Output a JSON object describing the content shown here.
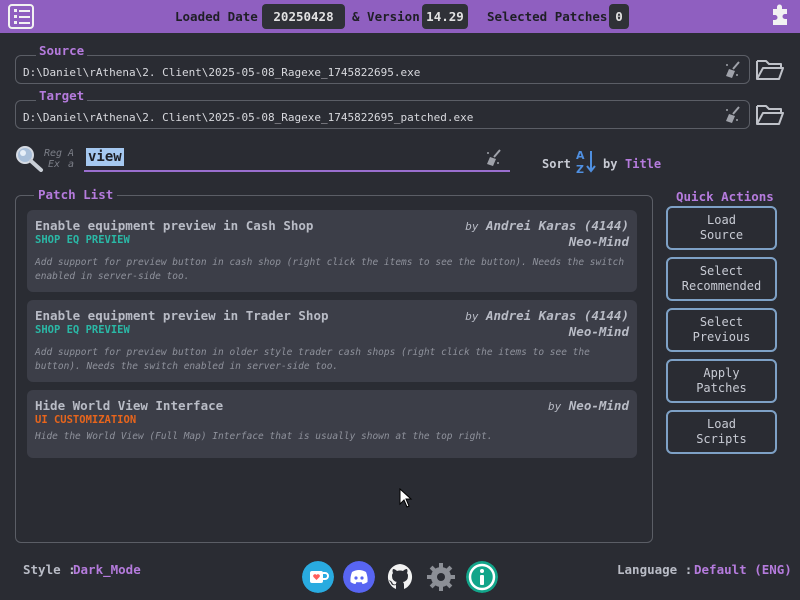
{
  "topbar": {
    "loaded_date_label": "Loaded Date",
    "loaded_date_value": "20250428",
    "version_label": "& Version",
    "version_value": "14.29",
    "selected_label": "Selected Patches",
    "selected_value": "0"
  },
  "source": {
    "label": "Source",
    "path": "D:\\Daniel\\rAthena\\2. Client\\2025-05-08_Ragexe_1745822695.exe"
  },
  "target": {
    "label": "Target",
    "path": "D:\\Daniel\\rAthena\\2. Client\\2025-05-08_Ragexe_1745822695_patched.exe"
  },
  "search": {
    "regex_top": "Reg",
    "regex_bottom": "Ex",
    "case_top": "A",
    "case_bottom": "a",
    "value": "view"
  },
  "sort": {
    "label": "Sort",
    "by_label": "by",
    "field": "Title"
  },
  "patch_list": {
    "label": "Patch List",
    "items": [
      {
        "title": "Enable equipment preview in Cash Shop",
        "tag": "SHOP EQ PREVIEW",
        "by": "by",
        "author": "Andrei Karas (4144)",
        "author2": "Neo-Mind",
        "description": "Add support for preview button in cash shop (right click the items to see the button). Needs the switch enabled in server-side too."
      },
      {
        "title": "Enable equipment preview in Trader Shop",
        "tag": "SHOP EQ PREVIEW",
        "by": "by",
        "author": "Andrei Karas (4144)",
        "author2": "Neo-Mind",
        "description": "Add support for preview button in older style trader cash shops (right click the items to see the button). Needs the switch enabled in server-side too."
      },
      {
        "title": "Hide World View Interface",
        "tag": "UI CUSTOMIZATION",
        "by": "by",
        "author": "Neo-Mind",
        "author2": "",
        "description": "Hide the World View (Full Map) Interface that is usually shown at the top right."
      }
    ]
  },
  "quick_actions": {
    "title": "Quick Actions",
    "buttons": [
      "Load\nSource",
      "Select\nRecommended",
      "Select\nPrevious",
      "Apply\nPatches",
      "Load\nScripts"
    ]
  },
  "footer": {
    "style_label": "Style :",
    "style_value": "Dark_Mode",
    "language_label": "Language :",
    "language_value": "Default (ENG)",
    "icons": [
      "kofi-icon",
      "discord-icon",
      "github-icon",
      "settings-icon",
      "info-icon"
    ]
  },
  "colors": {
    "accent": "#8f5fc0",
    "tag_teal": "#2ab8a6",
    "tag_orange": "#e8651c",
    "button_border": "#7ea1c6"
  }
}
